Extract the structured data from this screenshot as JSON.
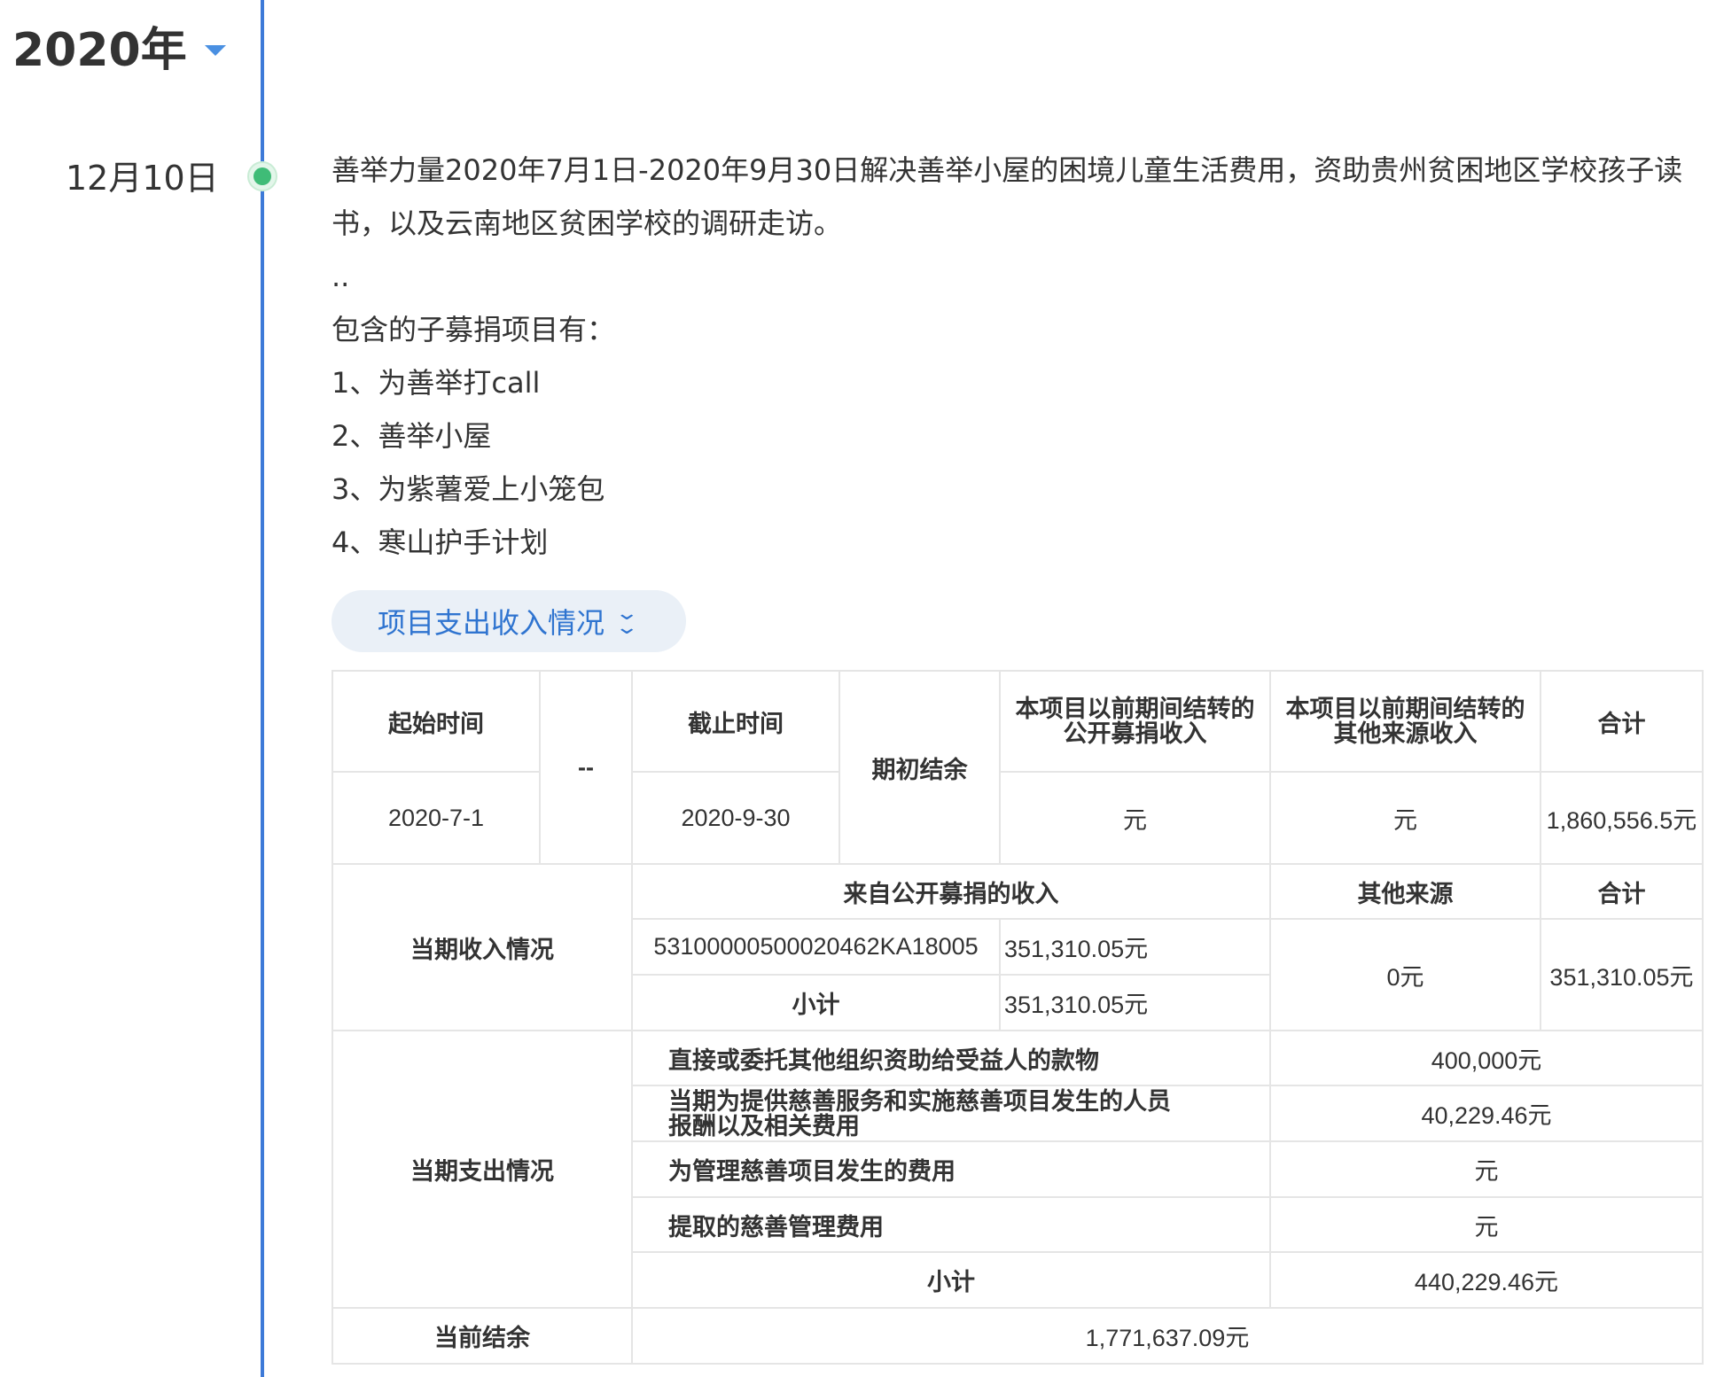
{
  "year": "2020年",
  "entry": {
    "date": "12月10日",
    "lines": [
      "善举力量2020年7月1日-2020年9月30日解决善举小屋的困境儿童生活费用，资助贵州贫困地区学校孩子读",
      "书，以及云南地区贫困学校的调研走访。",
      "..",
      "包含的子募捐项目有：",
      "1、为善举打call",
      "2、善举小屋",
      "3、为紫薯爱上小笼包",
      "4、寒山护手计划"
    ]
  },
  "toggle": {
    "label": "项目支出收入情况",
    "icon": "double-chevron-down-icon"
  },
  "table": {
    "header": {
      "start_time": "起始时间",
      "dash": "--",
      "end_time": "截止时间",
      "opening_balance": "期初结余",
      "prev_public_1": "本项目以前期间结转的",
      "prev_public_2": "公开募捐收入",
      "prev_other_1": "本项目以前期间结转的",
      "prev_other_2": "其他来源收入",
      "total": "合计"
    },
    "period": {
      "start": "2020-7-1",
      "end": "2020-9-30",
      "prev_public": "元",
      "prev_other": "元",
      "total": "1,860,556.5元"
    },
    "income": {
      "label": "当期收入情况",
      "public_header": "来自公开募捐的收入",
      "other_header": "其他来源",
      "total_header": "合计",
      "record_id": "53100000500020462KA18005",
      "record_amount": "351,310.05元",
      "subtotal_label": "小计",
      "subtotal_amount": "351,310.05元",
      "other_amount": "0元",
      "total_amount": "351,310.05元"
    },
    "expense": {
      "label": "当期支出情况",
      "rows": [
        {
          "label": "直接或委托其他组织资助给受益人的款物",
          "value": "400,000元"
        },
        {
          "label_1": "当期为提供慈善服务和实施慈善项目发生的人员",
          "label_2": "报酬以及相关费用",
          "value": "40,229.46元"
        },
        {
          "label": "为管理慈善项目发生的费用",
          "value": "元"
        },
        {
          "label": "提取的慈善管理费用",
          "value": "元"
        }
      ],
      "subtotal_label": "小计",
      "subtotal_value": "440,229.46元"
    },
    "balance": {
      "label": "当前结余",
      "value": "1,771,637.09元"
    }
  },
  "colors": {
    "timeline": "#3d7ad8",
    "dot": "#3fbc77",
    "link": "#2f74d0",
    "toggle_bg": "#eaf0f7",
    "border": "#e5e5e5"
  }
}
